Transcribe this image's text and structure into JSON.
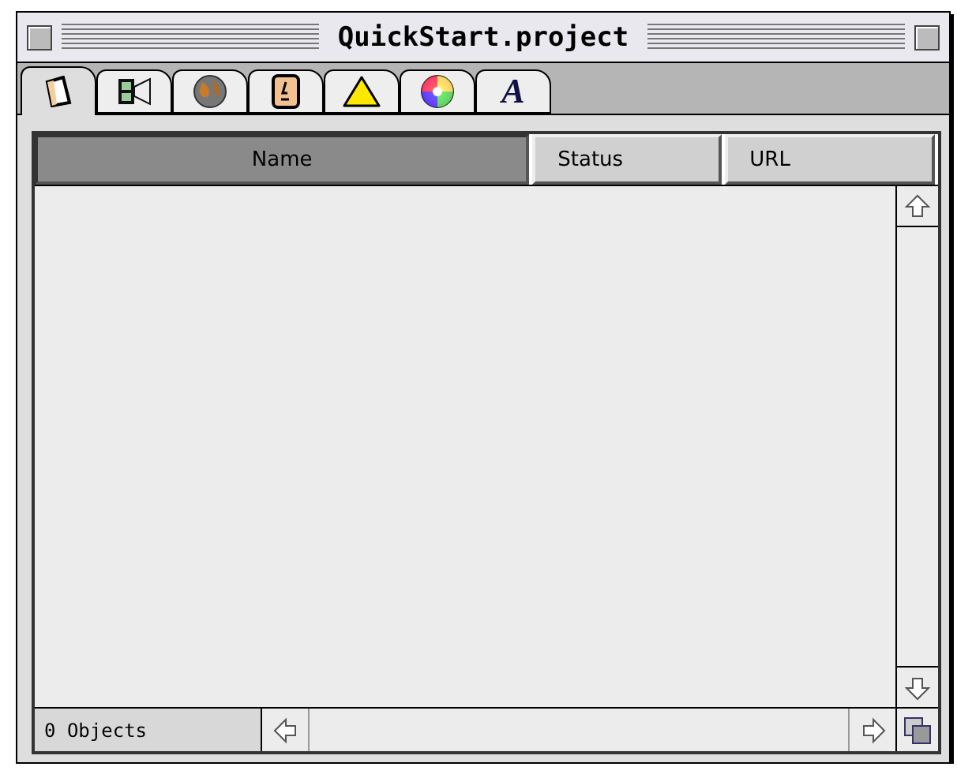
{
  "window": {
    "title": "QuickStart.project"
  },
  "tabs": [
    {
      "kind": "page",
      "selected": true
    },
    {
      "kind": "film",
      "selected": false
    },
    {
      "kind": "globe",
      "selected": false
    },
    {
      "kind": "face",
      "selected": false
    },
    {
      "kind": "triangle",
      "selected": false
    },
    {
      "kind": "colorwheel",
      "selected": false
    },
    {
      "kind": "letter",
      "label": "A",
      "selected": false
    }
  ],
  "table": {
    "columns": [
      {
        "label": "Name",
        "selected": true
      },
      {
        "label": "Status",
        "selected": false
      },
      {
        "label": "URL",
        "selected": false
      }
    ]
  },
  "status_bar": {
    "count": "0 Objects"
  }
}
